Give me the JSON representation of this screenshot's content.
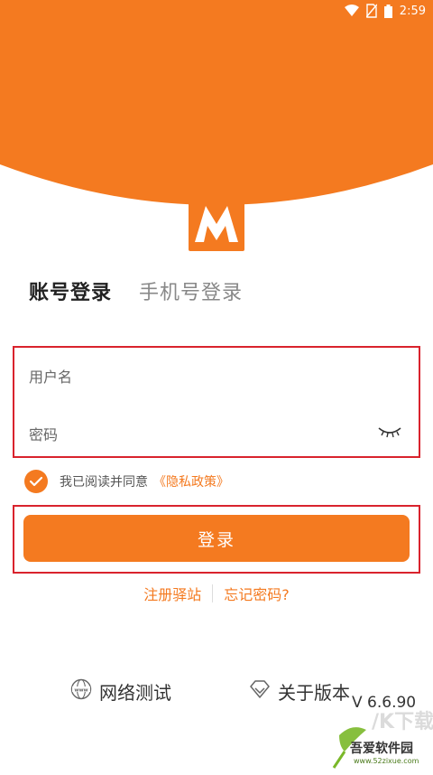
{
  "status_bar": {
    "time": "2:59",
    "icons": [
      "wifi-icon",
      "no-sim-icon",
      "battery-icon"
    ]
  },
  "colors": {
    "accent": "#f47a20",
    "highlight_border": "#d9232d"
  },
  "logo": {
    "letter": "M"
  },
  "tabs": [
    {
      "label": "账号登录",
      "active": true
    },
    {
      "label": "手机号登录",
      "active": false
    }
  ],
  "form": {
    "username_placeholder": "用户名",
    "username_value": "",
    "password_placeholder": "密码",
    "password_value": "",
    "password_toggle_icon": "eye-closed-icon"
  },
  "agreement": {
    "checked": true,
    "text": "我已阅读并同意",
    "link": "《隐私政策》"
  },
  "login_button": {
    "label": "登录"
  },
  "links": {
    "register": "注册驿站",
    "forgot": "忘记密码?"
  },
  "bottom": {
    "network_test": {
      "label": "网络测试",
      "icon": "globe-www-icon"
    },
    "about": {
      "label": "关于版本",
      "icon": "diamond-icon"
    },
    "version": "V 6.6.90"
  },
  "watermark": {
    "text": "吾爱软件园",
    "url": "www.52zixue.com"
  }
}
